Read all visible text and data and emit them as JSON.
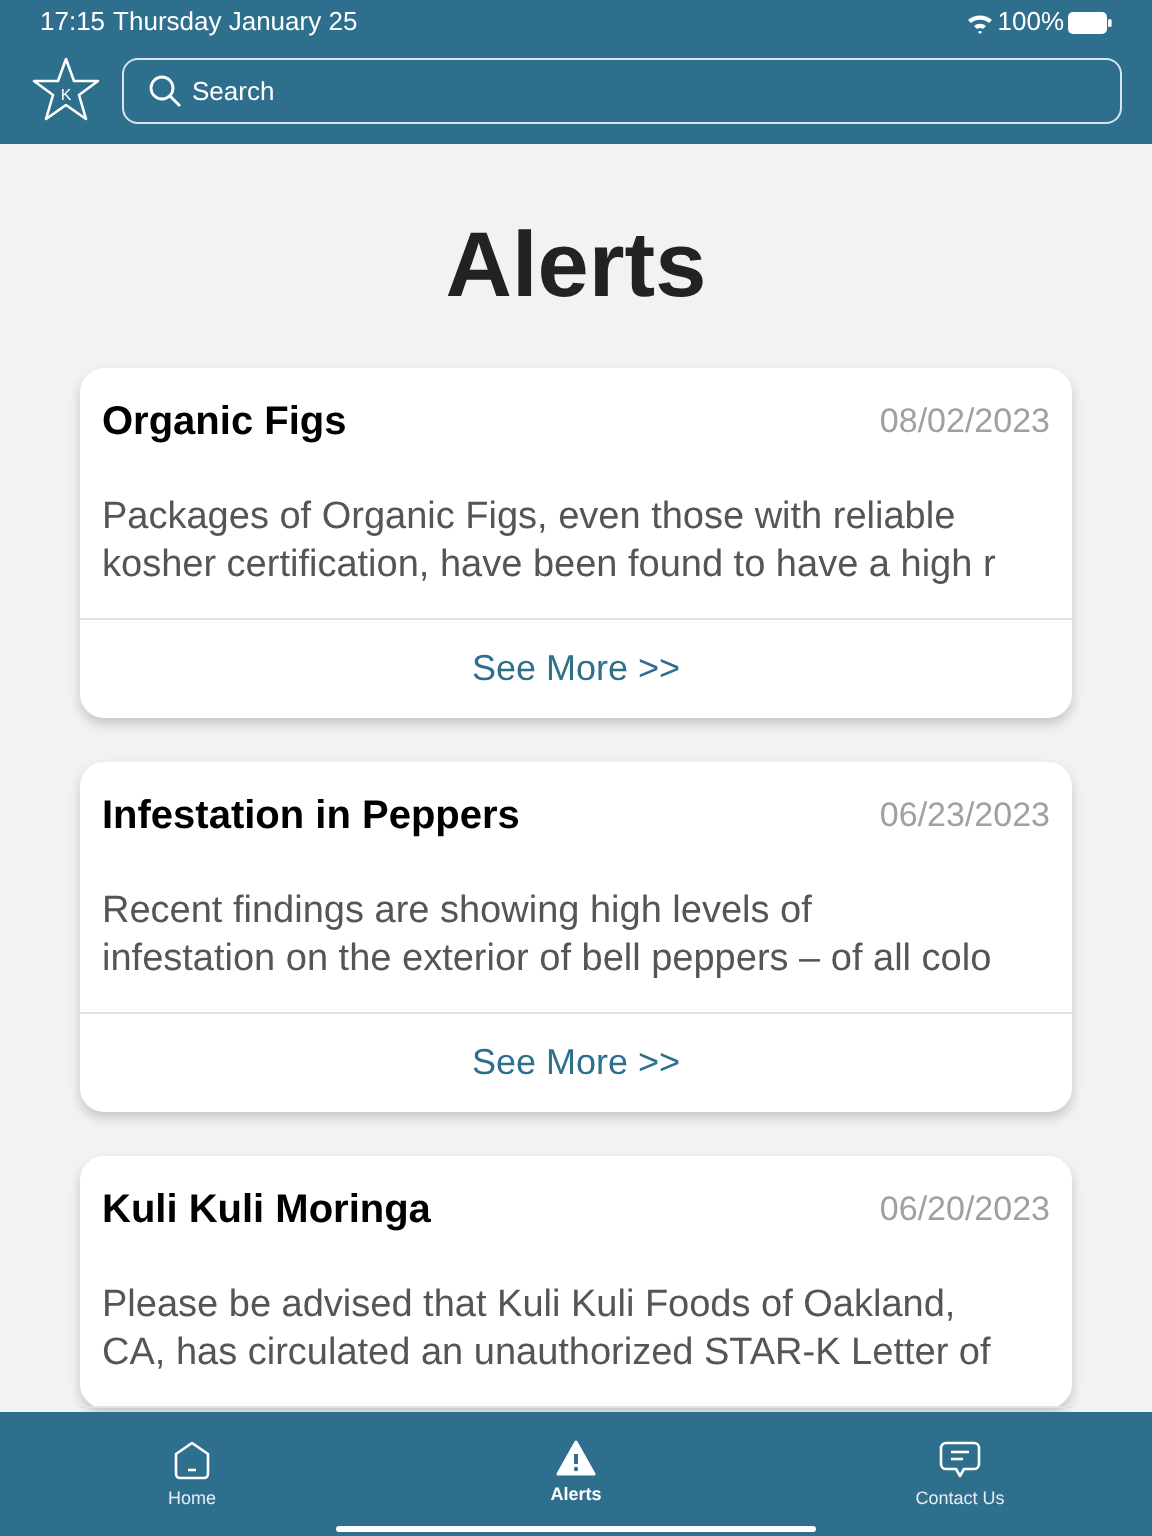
{
  "status_bar": {
    "time": "17:15",
    "date": "Thursday January 25",
    "battery": "100%"
  },
  "header": {
    "logo_letter": "K",
    "search": {
      "placeholder": "Search"
    }
  },
  "page_title": "Alerts",
  "alerts": [
    {
      "title": "Organic Figs",
      "date": "08/02/2023",
      "lines": [
        "Packages of Organic Figs, even those with reliable",
        "kosher certification, have been found to have a high r"
      ],
      "link": "See More >>"
    },
    {
      "title": "Infestation in Peppers",
      "date": "06/23/2023",
      "lines": [
        "Recent findings are showing high levels of",
        "infestation on the exterior of bell peppers – of all colo"
      ],
      "link": "See More >>"
    },
    {
      "title": "Kuli Kuli Moringa",
      "date": "06/20/2023",
      "lines": [
        "Please be advised that Kuli Kuli Foods of Oakland,",
        "CA, has circulated an unauthorized STAR-K Letter of"
      ]
    }
  ],
  "tab_bar": [
    {
      "kind": "home",
      "label": "Home",
      "selected": false
    },
    {
      "kind": "alerts",
      "label": "Alerts",
      "selected": true
    },
    {
      "kind": "contact",
      "label": "Contact Us",
      "selected": false
    }
  ]
}
